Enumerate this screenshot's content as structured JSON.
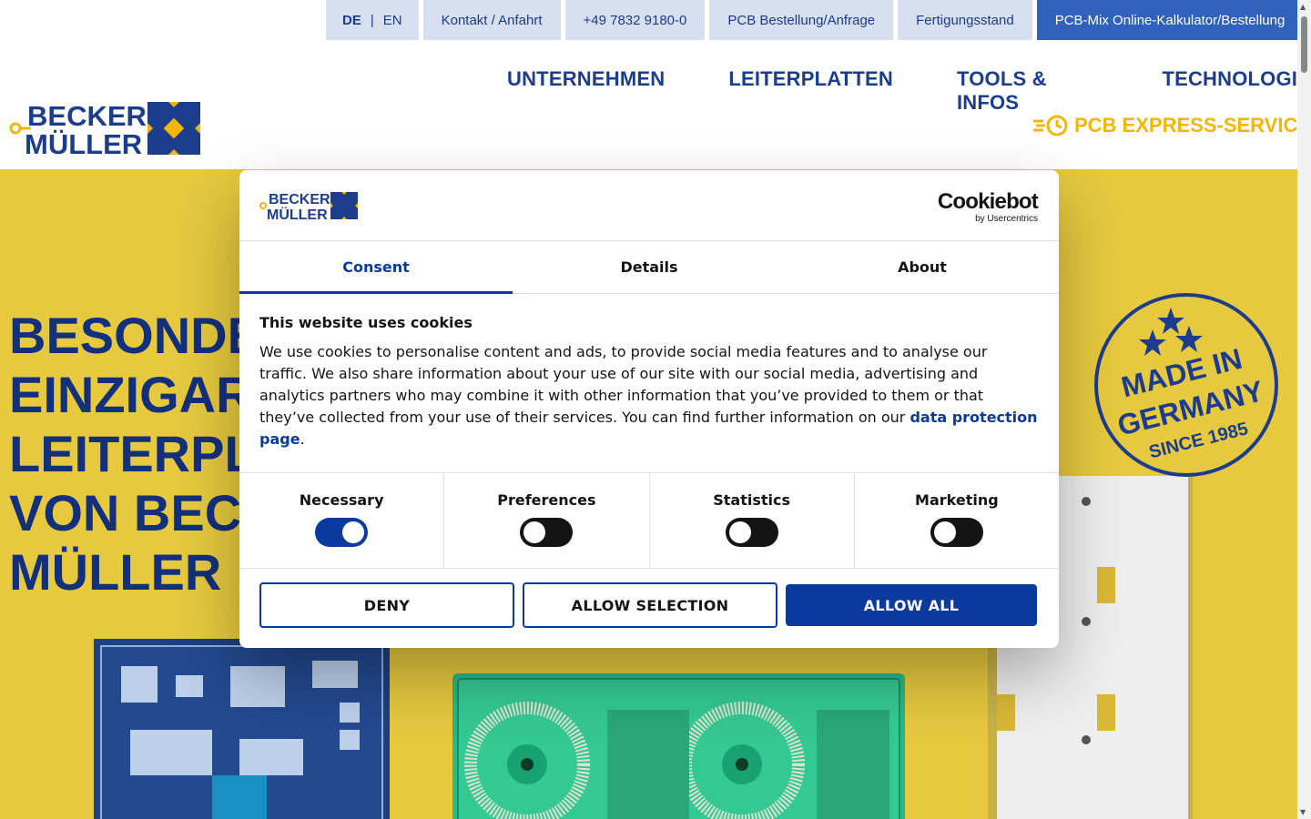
{
  "topbar": {
    "lang_active": "DE",
    "lang_sep": "|",
    "lang_other": "EN",
    "contact": "Kontakt / Anfahrt",
    "phone": "+49 7832 9180-0",
    "order": "PCB Bestellung/Anfrage",
    "status": "Fertigungsstand",
    "calculator": "PCB-Mix Online-Kalkulator/Bestellung"
  },
  "logo": {
    "line1": "BECKER",
    "line2": "MÜLLER"
  },
  "nav": {
    "items": [
      "UNTERNEHMEN",
      "LEITERPLATTEN",
      "TOOLS & INFOS",
      "TECHNOLOGIE"
    ],
    "express": "PCB EXPRESS-SERVICE"
  },
  "hero": {
    "lines": [
      "BESONDERS",
      "EINZIGARTIGE",
      "LEITERPLATTEN",
      "VON BECKER",
      "MÜLLER"
    ],
    "seal": {
      "line1": "MADE IN",
      "line2": "GERMANY",
      "line3": "SINCE 1985"
    }
  },
  "cookie": {
    "brand_main": "Cookiebot",
    "brand_sub": "by Usercentrics",
    "tabs": [
      "Consent",
      "Details",
      "About"
    ],
    "heading": "This website uses cookies",
    "text": "We use cookies to personalise content and ads, to provide social media features and to analyse our traffic. We also share information about your use of our site with our social media, advertising and analytics partners who may combine it with other information that you’ve provided to them or that they’ve collected from your use of their services. You can find further information on our ",
    "link": "data protection page",
    "text_end": ".",
    "categories": [
      {
        "label": "Necessary",
        "on": true
      },
      {
        "label": "Preferences",
        "on": false
      },
      {
        "label": "Statistics",
        "on": false
      },
      {
        "label": "Marketing",
        "on": false
      }
    ],
    "buttons": {
      "deny": "DENY",
      "selection": "ALLOW SELECTION",
      "all": "ALLOW ALL"
    }
  },
  "colors": {
    "brand_blue": "#1b3d8c",
    "accent_yellow": "#f2b705",
    "hero_bg": "#e6c93f",
    "consent_blue": "#0b3a9e"
  }
}
